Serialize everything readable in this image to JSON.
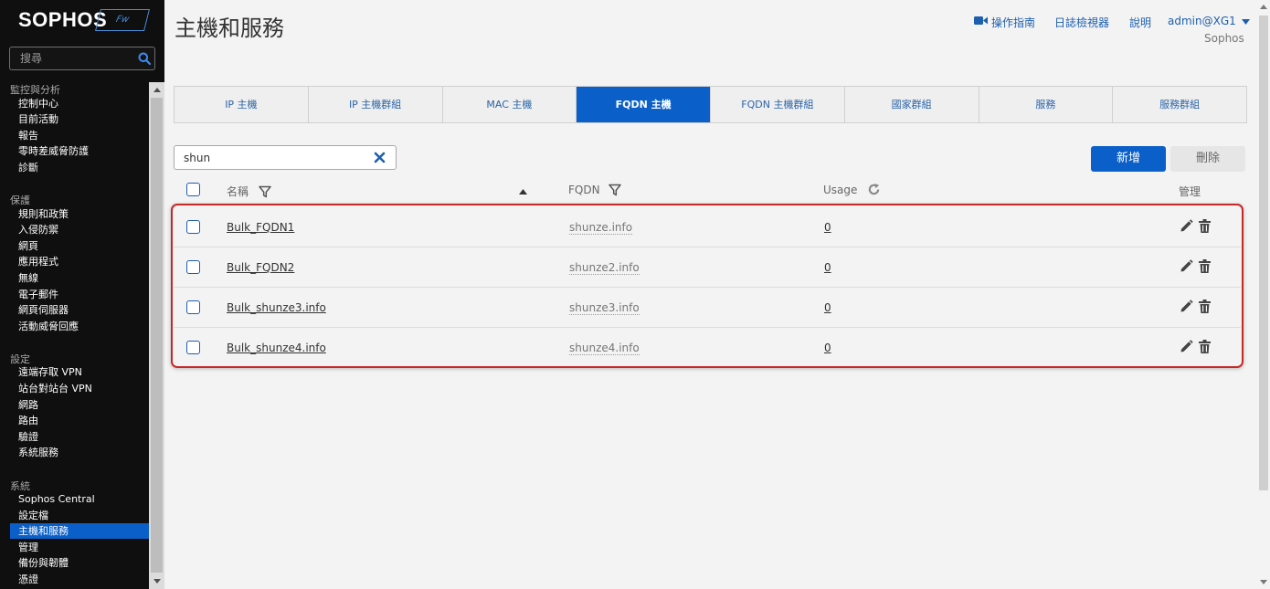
{
  "brand": {
    "logo": "SOPHOS",
    "badge": "Fw"
  },
  "sidebar": {
    "search_placeholder": "搜尋",
    "sections": [
      {
        "title": "監控與分析",
        "items": [
          "控制中心",
          "目前活動",
          "報告",
          "零時差威脅防護",
          "診斷"
        ]
      },
      {
        "title": "保護",
        "items": [
          "規則和政策",
          "入侵防禦",
          "網頁",
          "應用程式",
          "無線",
          "電子郵件",
          "網頁伺服器",
          "活動威脅回應"
        ]
      },
      {
        "title": "設定",
        "items": [
          "遠端存取 VPN",
          "站台對站台 VPN",
          "網路",
          "路由",
          "驗證",
          "系統服務"
        ]
      },
      {
        "title": "系統",
        "items": [
          "Sophos Central",
          "設定檔",
          "主機和服務",
          "管理",
          "備份與韌體",
          "憑證"
        ]
      }
    ],
    "active_item": "主機和服務"
  },
  "header": {
    "title": "主機和服務",
    "links": {
      "guide": "操作指南",
      "log_viewer": "日誌檢視器",
      "help": "說明",
      "user": "admin@XG1"
    },
    "subtitle": "Sophos"
  },
  "tabs": [
    "IP 主機",
    "IP 主機群組",
    "MAC 主機",
    "FQDN 主機",
    "FQDN 主機群組",
    "國家群組",
    "服務",
    "服務群組"
  ],
  "active_tab": "FQDN 主機",
  "filter": {
    "value": "shun"
  },
  "buttons": {
    "add": "新增",
    "delete": "刪除"
  },
  "table": {
    "columns": {
      "name": "名稱",
      "fqdn": "FQDN",
      "usage": "Usage",
      "manage": "管理"
    },
    "rows": [
      {
        "name": "Bulk_FQDN1",
        "fqdn": "shunze.info",
        "usage": "0"
      },
      {
        "name": "Bulk_FQDN2",
        "fqdn": "shunze2.info",
        "usage": "0"
      },
      {
        "name": "Bulk_shunze3.info",
        "fqdn": "shunze3.info",
        "usage": "0"
      },
      {
        "name": "Bulk_shunze4.info",
        "fqdn": "shunze4.info",
        "usage": "0"
      }
    ]
  },
  "colors": {
    "accent": "#0a5fc8",
    "sidebar_bg": "#0f0f0f",
    "highlight_border": "#c62828"
  }
}
